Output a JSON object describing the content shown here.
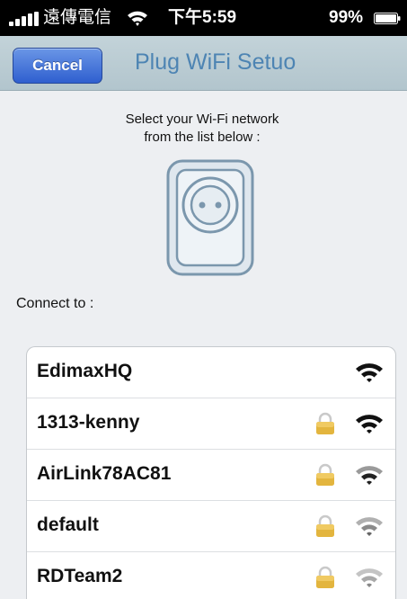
{
  "status_bar": {
    "carrier": "遠傳電信",
    "time": "下午5:59",
    "battery": "99%"
  },
  "nav": {
    "cancel_label": "Cancel",
    "title": "Plug WiFi Setuo"
  },
  "instruction": {
    "line1": "Select your Wi-Fi network",
    "line2": "from the list below :"
  },
  "connect_label": "Connect to :",
  "networks": [
    {
      "name": "EdimaxHQ",
      "locked": false,
      "signal": "strong"
    },
    {
      "name": "1313-kenny",
      "locked": true,
      "signal": "strong"
    },
    {
      "name": "AirLink78AC81",
      "locked": true,
      "signal": "good"
    },
    {
      "name": "default",
      "locked": true,
      "signal": "weak"
    },
    {
      "name": "RDTeam2",
      "locked": true,
      "signal": "weak"
    }
  ],
  "colors": {
    "nav_background": "#b8cad1",
    "cancel_button": "#3a6fd8",
    "title_text": "#4d84b3",
    "plug_stroke": "#7b97ad",
    "lock_color": "#e3b53e"
  }
}
